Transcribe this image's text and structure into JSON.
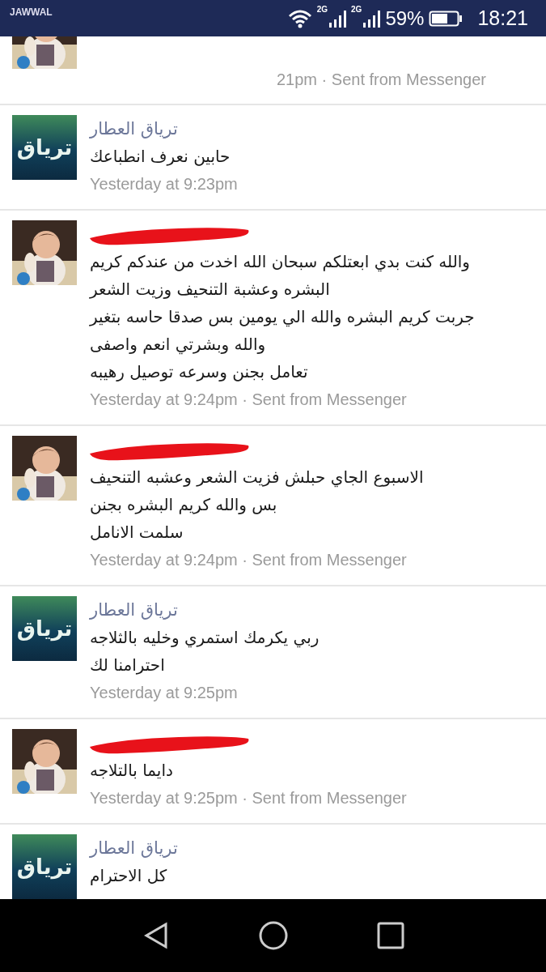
{
  "status_bar": {
    "carrier": "JAWWAL",
    "network_1": "2G",
    "network_2": "2G",
    "battery": "59%",
    "time": "18:21"
  },
  "partial_top": {
    "timestamp": "21pm · Sent from Messenger"
  },
  "messages": [
    {
      "kind": "page",
      "avatar_text": "ترياق",
      "name": "ترياق العطار",
      "lines": [
        "حابين نعرف انطباعك"
      ],
      "timestamp": "Yesterday at 9:23pm"
    },
    {
      "kind": "redacted",
      "lines": [
        "والله كنت بدي ابعتلكم سبحان الله اخدت من عندكم كريم",
        "البشره وعشبة التنحيف وزيت الشعر",
        "جربت كريم البشره والله الي يومين بس صدقا حاسه بتغير",
        "والله وبشرتي انعم واصفى",
        "تعامل بجنن وسرعه توصيل رهيبه"
      ],
      "timestamp": "Yesterday at 9:24pm · Sent from Messenger"
    },
    {
      "kind": "redacted",
      "lines": [
        "الاسبوع الجاي حبلش فزيت الشعر وعشبه التنحيف",
        "بس والله كريم البشره بجنن",
        "سلمت الانامل"
      ],
      "timestamp": "Yesterday at 9:24pm · Sent from Messenger"
    },
    {
      "kind": "page",
      "avatar_text": "ترياق",
      "name": "ترياق العطار",
      "lines": [
        "ربي يكرمك استمري وخليه بالثلاجه",
        "احترامنا لك"
      ],
      "timestamp": "Yesterday at 9:25pm"
    },
    {
      "kind": "redacted",
      "lines": [
        "دايما بالتلاجه"
      ],
      "timestamp": "Yesterday at 9:25pm · Sent from Messenger"
    },
    {
      "kind": "page",
      "avatar_text": "ترياق",
      "name": "ترياق العطار",
      "lines": [
        "كل الاحترام"
      ]
    }
  ]
}
